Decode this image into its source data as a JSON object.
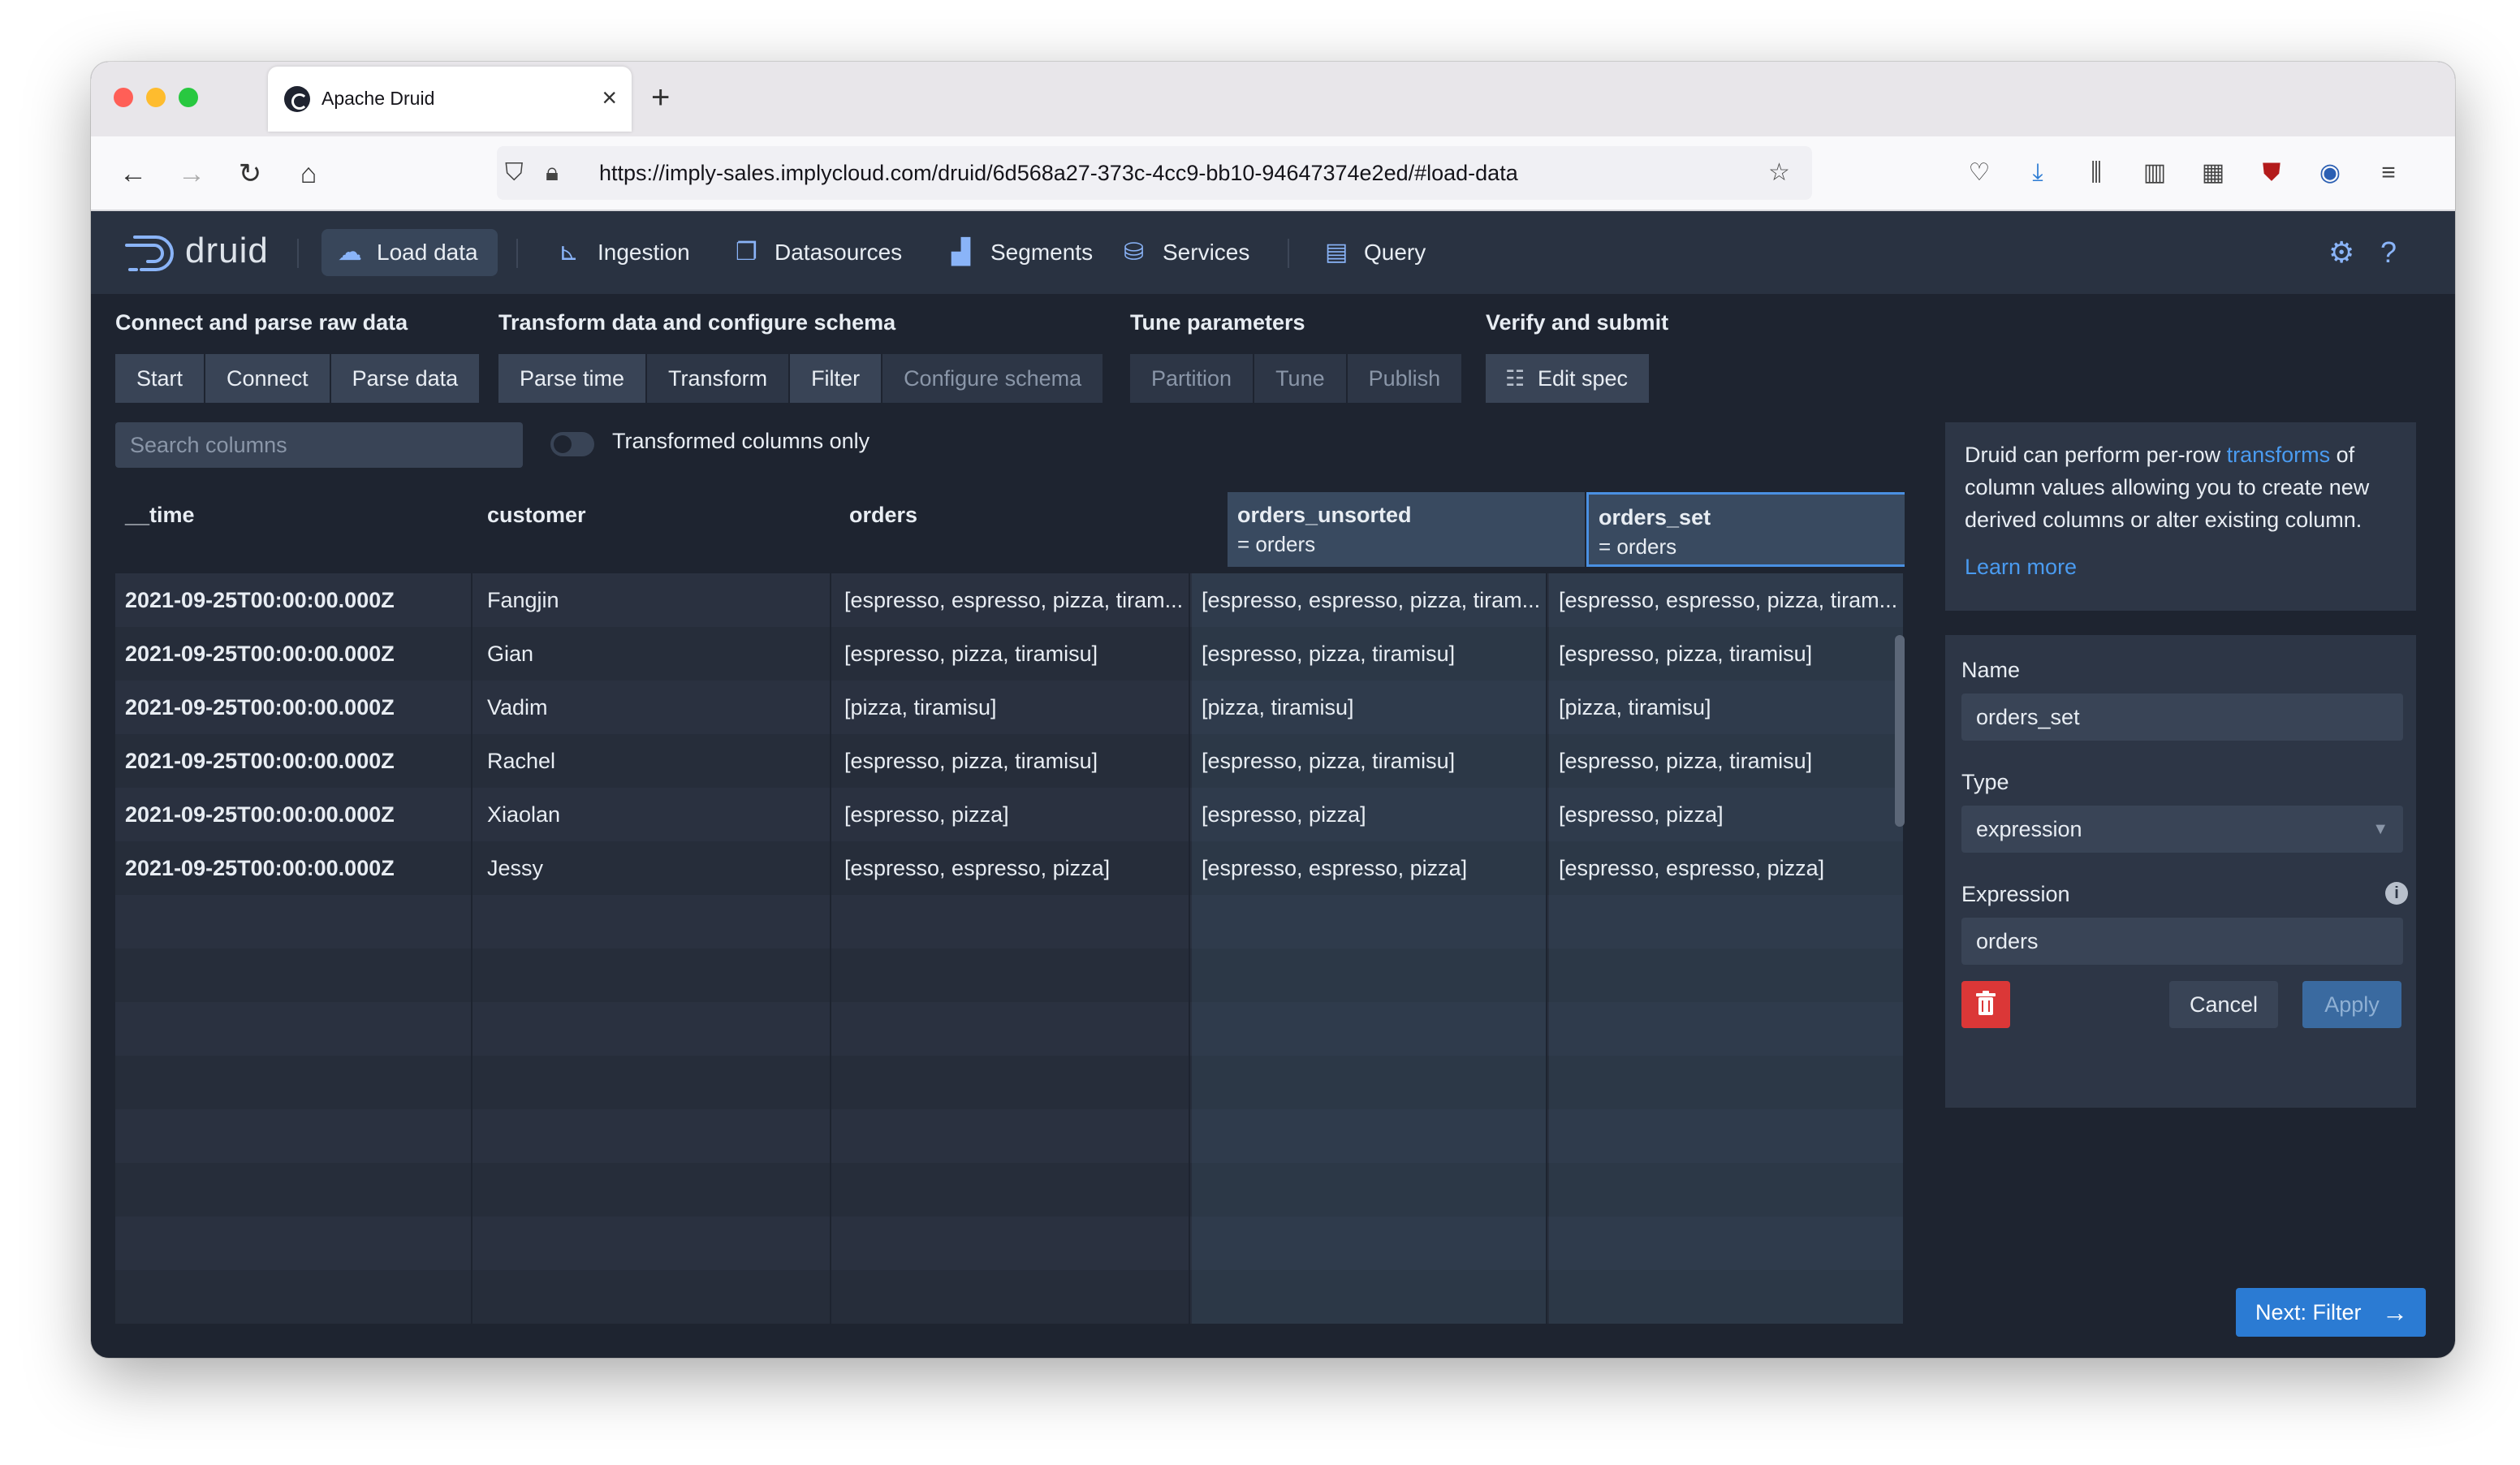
{
  "browser": {
    "tab_title": "Apache Druid",
    "url": "https://imply-sales.implycloud.com/druid/6d568a27-373c-4cc9-bb10-94647374e2ed/#load-data"
  },
  "app": {
    "logo_text": "druid",
    "nav": {
      "load_data": "Load data",
      "ingestion": "Ingestion",
      "datasources": "Datasources",
      "segments": "Segments",
      "services": "Services",
      "query": "Query"
    }
  },
  "steps": {
    "connect_header": "Connect and parse raw data",
    "transform_header": "Transform data and configure schema",
    "tune_header": "Tune parameters",
    "verify_header": "Verify and submit",
    "start": "Start",
    "connect": "Connect",
    "parse_data": "Parse data",
    "parse_time": "Parse time",
    "transform": "Transform",
    "filter": "Filter",
    "configure_schema": "Configure schema",
    "partition": "Partition",
    "tune": "Tune",
    "publish": "Publish",
    "edit_spec": "Edit spec"
  },
  "filters": {
    "search_placeholder": "Search columns",
    "transformed_only": "Transformed columns only"
  },
  "table": {
    "columns": [
      {
        "name": "__time",
        "sub": ""
      },
      {
        "name": "customer",
        "sub": ""
      },
      {
        "name": "orders",
        "sub": ""
      },
      {
        "name": "orders_unsorted",
        "sub": "= orders"
      },
      {
        "name": "orders_set",
        "sub": "= orders"
      }
    ],
    "rows": [
      [
        "2021-09-25T00:00:00.000Z",
        "Fangjin",
        "[espresso, espresso, pizza, tiram...",
        "[espresso, espresso, pizza, tiram...",
        "[espresso, espresso, pizza, tiram..."
      ],
      [
        "2021-09-25T00:00:00.000Z",
        "Gian",
        "[espresso, pizza, tiramisu]",
        "[espresso, pizza, tiramisu]",
        "[espresso, pizza, tiramisu]"
      ],
      [
        "2021-09-25T00:00:00.000Z",
        "Vadim",
        "[pizza, tiramisu]",
        "[pizza, tiramisu]",
        "[pizza, tiramisu]"
      ],
      [
        "2021-09-25T00:00:00.000Z",
        "Rachel",
        "[espresso, pizza, tiramisu]",
        "[espresso, pizza, tiramisu]",
        "[espresso, pizza, tiramisu]"
      ],
      [
        "2021-09-25T00:00:00.000Z",
        "Xiaolan",
        "[espresso, pizza]",
        "[espresso, pizza]",
        "[espresso, pizza]"
      ],
      [
        "2021-09-25T00:00:00.000Z",
        "Jessy",
        "[espresso, espresso, pizza]",
        "[espresso, espresso, pizza]",
        "[espresso, espresso, pizza]"
      ]
    ]
  },
  "panel": {
    "info_pre": "Druid can perform per-row ",
    "info_link": "transforms",
    "info_post": " of column values allowing you to create new derived columns or alter existing column.",
    "learn_more": "Learn more",
    "name_label": "Name",
    "name_value": "orders_set",
    "type_label": "Type",
    "type_value": "expression",
    "expression_label": "Expression",
    "expression_value": "orders",
    "cancel": "Cancel",
    "apply": "Apply"
  },
  "next_button": "Next: Filter",
  "colors": {
    "accent": "#2b7bd3",
    "danger": "#db3737",
    "header_bg": "#293241",
    "body_bg": "#1e2430"
  }
}
